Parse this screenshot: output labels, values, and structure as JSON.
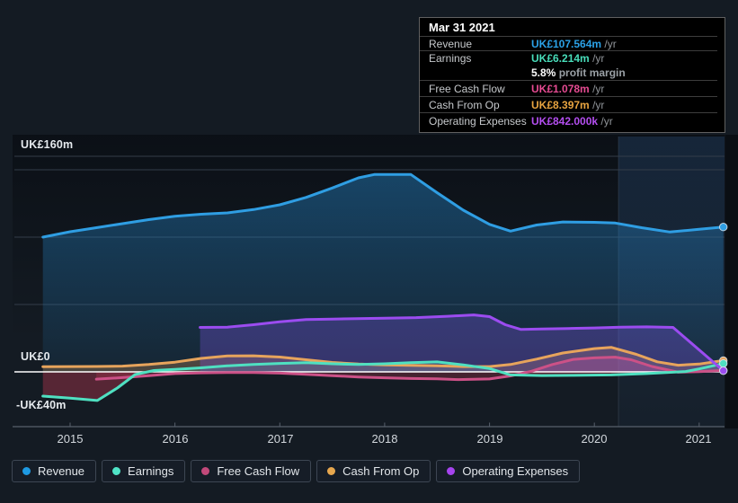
{
  "tooltip": {
    "date": "Mar 31 2021",
    "rows": [
      {
        "label": "Revenue",
        "value": "UK£107.564m",
        "unit": "/yr",
        "color": "#2ba2e8"
      },
      {
        "label": "Earnings",
        "value": "UK£6.214m",
        "unit": "/yr",
        "color": "#48ddba"
      },
      {
        "label": "Free Cash Flow",
        "value": "UK£1.078m",
        "unit": "/yr",
        "color": "#e64b92"
      },
      {
        "label": "Cash From Op",
        "value": "UK£8.397m",
        "unit": "/yr",
        "color": "#e8a440"
      },
      {
        "label": "Operating Expenses",
        "value": "UK£842.000k",
        "unit": "/yr",
        "color": "#b44ef0"
      }
    ],
    "profit_margin_bold": "5.8%",
    "profit_margin_text": "profit margin"
  },
  "legend": {
    "items": [
      {
        "label": "Revenue",
        "color": "#1e9ae3"
      },
      {
        "label": "Earnings",
        "color": "#4fe3c6"
      },
      {
        "label": "Free Cash Flow",
        "color": "#c2497a"
      },
      {
        "label": "Cash From Op",
        "color": "#e7a74e"
      },
      {
        "label": "Operating Expenses",
        "color": "#a644ef"
      }
    ]
  },
  "chart_data": {
    "type": "area",
    "title": "",
    "xlabel": "",
    "ylabel": "",
    "ylim": [
      -40,
      160
    ],
    "xlim": [
      2014.74,
      2021.23
    ],
    "grid": true,
    "y_labels": [
      "UK£160m",
      "UK£0",
      "-UK£40m"
    ],
    "gridline_values": [
      160,
      150,
      100,
      50
    ],
    "x_ticks": [
      "2015",
      "2016",
      "2017",
      "2018",
      "2019",
      "2020",
      "2021"
    ],
    "x_tick_years": [
      2015,
      2016,
      2017,
      2018,
      2019,
      2020,
      2021
    ],
    "units": "UK£ millions per year",
    "series": [
      {
        "name": "Revenue",
        "color": "#2f9ee3",
        "fill_pos": "gradRev",
        "points": [
          [
            2014.74,
            100
          ],
          [
            2015.0,
            104
          ],
          [
            2015.25,
            107
          ],
          [
            2015.5,
            110
          ],
          [
            2015.75,
            113
          ],
          [
            2016.0,
            115.5
          ],
          [
            2016.25,
            117
          ],
          [
            2016.5,
            118
          ],
          [
            2016.75,
            120.5
          ],
          [
            2017.0,
            124
          ],
          [
            2017.25,
            129.5
          ],
          [
            2017.5,
            136.5
          ],
          [
            2017.75,
            144
          ],
          [
            2017.9,
            146.5
          ],
          [
            2018.25,
            146.5
          ],
          [
            2018.5,
            133
          ],
          [
            2018.75,
            120
          ],
          [
            2019.0,
            109.5
          ],
          [
            2019.2,
            104.5
          ],
          [
            2019.45,
            109
          ],
          [
            2019.7,
            111.3
          ],
          [
            2020.0,
            111
          ],
          [
            2020.2,
            110.5
          ],
          [
            2020.45,
            107
          ],
          [
            2020.72,
            103.8
          ],
          [
            2021.0,
            105.8
          ],
          [
            2021.23,
            107.564
          ]
        ]
      },
      {
        "name": "Cash From Op",
        "color": "#e7a45c",
        "fill_pos": "rgba(231,164,92,0.26)",
        "points": [
          [
            2014.74,
            3.8
          ],
          [
            2015.0,
            3.9
          ],
          [
            2015.25,
            4.0
          ],
          [
            2015.5,
            4.3
          ],
          [
            2015.75,
            5.5
          ],
          [
            2016.0,
            7.2
          ],
          [
            2016.25,
            10
          ],
          [
            2016.5,
            11.8
          ],
          [
            2016.75,
            11.9
          ],
          [
            2017.0,
            11
          ],
          [
            2017.25,
            9
          ],
          [
            2017.5,
            7
          ],
          [
            2017.75,
            5.8
          ],
          [
            2018.0,
            5.2
          ],
          [
            2018.25,
            4.8
          ],
          [
            2018.5,
            4.5
          ],
          [
            2018.75,
            3.9
          ],
          [
            2019.0,
            3.9
          ],
          [
            2019.2,
            5.5
          ],
          [
            2019.45,
            9.5
          ],
          [
            2019.7,
            14
          ],
          [
            2020.0,
            17.3
          ],
          [
            2020.16,
            18.2
          ],
          [
            2020.4,
            13
          ],
          [
            2020.6,
            7.5
          ],
          [
            2020.8,
            4.9
          ],
          [
            2021.0,
            5.8
          ],
          [
            2021.23,
            8.397
          ]
        ]
      },
      {
        "name": "Free Cash Flow",
        "color": "#cc5187",
        "fill_pos": "rgba(210,78,140,0.32)",
        "fill_neg": "rgba(196,58,83,0.28)",
        "points": [
          [
            2015.25,
            -5.4
          ],
          [
            2015.5,
            -4.3
          ],
          [
            2015.75,
            -2.8
          ],
          [
            2016.0,
            -1.3
          ],
          [
            2016.25,
            -0.7
          ],
          [
            2016.5,
            -0.5
          ],
          [
            2016.75,
            -0.5
          ],
          [
            2017.0,
            -0.9
          ],
          [
            2017.25,
            -1.8
          ],
          [
            2017.5,
            -2.8
          ],
          [
            2017.75,
            -3.8
          ],
          [
            2018.0,
            -4.4
          ],
          [
            2018.25,
            -4.9
          ],
          [
            2018.5,
            -5.2
          ],
          [
            2018.7,
            -5.7
          ],
          [
            2019.0,
            -5.3
          ],
          [
            2019.2,
            -3
          ],
          [
            2019.4,
            0.5
          ],
          [
            2019.6,
            5.5
          ],
          [
            2019.8,
            9.3
          ],
          [
            2020.0,
            10.4
          ],
          [
            2020.2,
            10.9
          ],
          [
            2020.35,
            9
          ],
          [
            2020.55,
            4
          ],
          [
            2020.8,
            -0.3
          ],
          [
            2021.0,
            0.2
          ],
          [
            2021.23,
            1.078
          ]
        ]
      },
      {
        "name": "Earnings",
        "color": "#4fe0c1",
        "fill_pos": "rgba(79,224,193,0.14)",
        "fill_neg": "rgba(196,58,83,0.38)",
        "points": [
          [
            2014.74,
            -18
          ],
          [
            2015.0,
            -19.5
          ],
          [
            2015.26,
            -21.3
          ],
          [
            2015.45,
            -12
          ],
          [
            2015.62,
            -2
          ],
          [
            2015.8,
            1
          ],
          [
            2016.0,
            1.8
          ],
          [
            2016.25,
            3
          ],
          [
            2016.5,
            4.5
          ],
          [
            2016.75,
            5.5
          ],
          [
            2017.0,
            6.3
          ],
          [
            2017.25,
            6.8
          ],
          [
            2017.5,
            6
          ],
          [
            2017.75,
            5.5
          ],
          [
            2018.0,
            6
          ],
          [
            2018.25,
            6.8
          ],
          [
            2018.5,
            7.4
          ],
          [
            2018.75,
            5.2
          ],
          [
            2019.0,
            2.5
          ],
          [
            2019.2,
            -2.3
          ],
          [
            2019.5,
            -2.7
          ],
          [
            2019.8,
            -2.6
          ],
          [
            2020.16,
            -2.3
          ],
          [
            2020.5,
            -1.3
          ],
          [
            2020.87,
            0.3
          ],
          [
            2021.0,
            2.2
          ],
          [
            2021.23,
            6.214
          ]
        ]
      },
      {
        "name": "Operating Expenses",
        "color": "#9b4cf0",
        "fill_pos": "rgba(130,85,235,0.30)",
        "points": [
          [
            2016.24,
            33
          ],
          [
            2016.5,
            33.2
          ],
          [
            2016.75,
            35
          ],
          [
            2017.0,
            37.2
          ],
          [
            2017.25,
            38.8
          ],
          [
            2017.5,
            39.2
          ],
          [
            2018.0,
            39.8
          ],
          [
            2018.3,
            40.3
          ],
          [
            2018.6,
            41.3
          ],
          [
            2018.85,
            42.3
          ],
          [
            2019.0,
            41
          ],
          [
            2019.15,
            35
          ],
          [
            2019.3,
            31.5
          ],
          [
            2019.5,
            31.8
          ],
          [
            2019.75,
            32.2
          ],
          [
            2020.0,
            32.6
          ],
          [
            2020.25,
            33.2
          ],
          [
            2020.5,
            33.4
          ],
          [
            2020.75,
            33
          ],
          [
            2021.23,
            0.842
          ]
        ]
      }
    ]
  }
}
